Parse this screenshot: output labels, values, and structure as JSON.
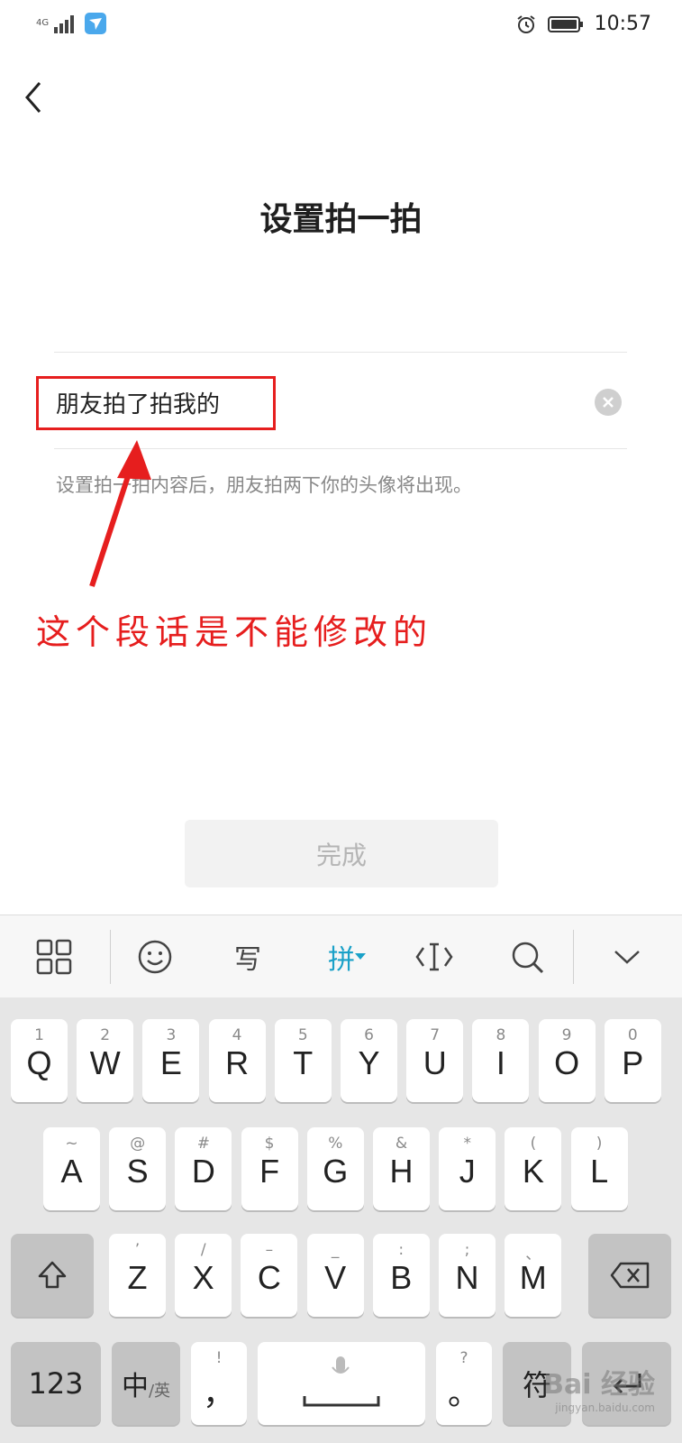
{
  "status_bar": {
    "network": "4G",
    "time": "10:57"
  },
  "page": {
    "title": "设置拍一拍",
    "input_value": "朋友拍了拍我的",
    "hint": "设置拍一拍内容后，朋友拍两下你的头像将出现。",
    "done_label": "完成"
  },
  "annotation": {
    "text": "这个段话是不能修改的",
    "color": "#e61e1e"
  },
  "keyboard": {
    "toolbar": {
      "handwrite": "写",
      "pinyin": "拼"
    },
    "row1": [
      {
        "main": "Q",
        "sub": "1"
      },
      {
        "main": "W",
        "sub": "2"
      },
      {
        "main": "E",
        "sub": "3"
      },
      {
        "main": "R",
        "sub": "4"
      },
      {
        "main": "T",
        "sub": "5"
      },
      {
        "main": "Y",
        "sub": "6"
      },
      {
        "main": "U",
        "sub": "7"
      },
      {
        "main": "I",
        "sub": "8"
      },
      {
        "main": "O",
        "sub": "9"
      },
      {
        "main": "P",
        "sub": "0"
      }
    ],
    "row2": [
      {
        "main": "A",
        "sub": "~"
      },
      {
        "main": "S",
        "sub": "@"
      },
      {
        "main": "D",
        "sub": "#"
      },
      {
        "main": "F",
        "sub": "$"
      },
      {
        "main": "G",
        "sub": "%"
      },
      {
        "main": "H",
        "sub": "&"
      },
      {
        "main": "J",
        "sub": "*"
      },
      {
        "main": "K",
        "sub": "("
      },
      {
        "main": "L",
        "sub": ")"
      }
    ],
    "row3": [
      {
        "main": "Z",
        "sub": "’"
      },
      {
        "main": "X",
        "sub": "/"
      },
      {
        "main": "C",
        "sub": "–"
      },
      {
        "main": "V",
        "sub": "_"
      },
      {
        "main": "B",
        "sub": ":"
      },
      {
        "main": "N",
        "sub": ";"
      },
      {
        "main": "M",
        "sub": "、"
      }
    ],
    "bottom": {
      "num": "123",
      "zh": "中",
      "en": "/英",
      "comma_sub": "!",
      "comma_main": "，",
      "period_sub": "?",
      "period_main": "。",
      "symbols": "符"
    }
  },
  "watermark": {
    "brand": "Bai 经验",
    "url": "jingyan.baidu.com"
  },
  "colors": {
    "accent": "#1aa1c8",
    "annotation_red": "#e61e1e"
  }
}
